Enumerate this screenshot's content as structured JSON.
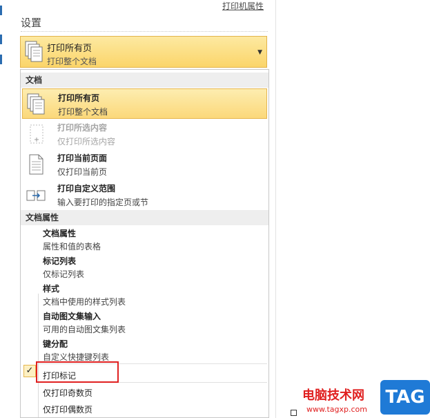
{
  "printer_properties_link": "打印机属性",
  "settings_title": "设置",
  "dropdown": {
    "line1": "打印所有页",
    "line2": "打印整个文档",
    "icon": "pages-stack-icon"
  },
  "menu": {
    "document_header": "文档",
    "document_items": [
      {
        "title": "打印所有页",
        "subtitle": "打印整个文档",
        "icon": "pages-stack-icon",
        "selected": true
      },
      {
        "title": "打印所选内容",
        "subtitle": "仅打印所选内容",
        "icon": "selection-icon",
        "disabled": true
      },
      {
        "title": "打印当前页面",
        "subtitle": "仅打印当前页",
        "icon": "single-page-icon"
      },
      {
        "title": "打印自定义范围",
        "subtitle": "输入要打印的指定页或节",
        "icon": "custom-range-icon"
      }
    ],
    "properties_header": "文档属性",
    "property_items": [
      {
        "title": "文档属性",
        "subtitle": "属性和值的表格"
      },
      {
        "title": "标记列表",
        "subtitle": "仅标记列表"
      },
      {
        "title": "样式",
        "subtitle": "文档中使用的样式列表"
      },
      {
        "title": "自动图文集输入",
        "subtitle": "可用的自动图文集列表"
      },
      {
        "title": "键分配",
        "subtitle": "自定义快捷键列表"
      }
    ],
    "print_markup": "打印标记",
    "print_markup_check": "✓",
    "odd_pages": "仅打印奇数页",
    "even_pages": "仅打印偶数页"
  },
  "watermark": {
    "cn": "电脑技术网",
    "url": "www.tagxp.com",
    "tag": "TAG"
  }
}
